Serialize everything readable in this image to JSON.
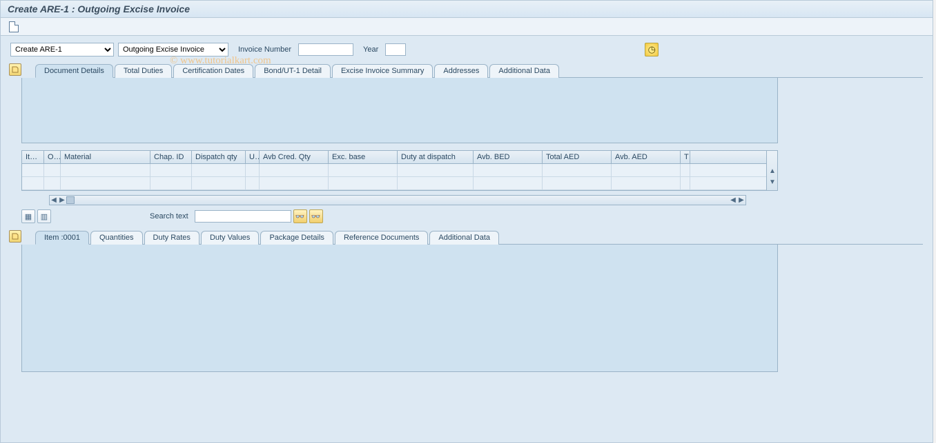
{
  "page_title": "Create ARE-1 : Outgoing Excise Invoice",
  "watermark": "© www.tutorialkart.com",
  "topbar": {
    "create_select": "Create ARE-1",
    "ref_select": "Outgoing Excise Invoice",
    "invoice_label": "Invoice Number",
    "invoice_value": "",
    "year_label": "Year",
    "year_value": ""
  },
  "tabs_main": [
    "Document Details",
    "Total Duties",
    "Certification Dates",
    "Bond/UT-1 Detail",
    "Excise Invoice Summary",
    "Addresses",
    "Additional Data"
  ],
  "active_tab_main": 0,
  "grid": {
    "columns": [
      "Item",
      "OK",
      "Material",
      "Chap. ID",
      "Dispatch qty",
      "U...",
      "Avb Cred. Qty",
      "Exc. base",
      "Duty at dispatch",
      "Avb. BED",
      "Total AED",
      "Avb. AED",
      "T"
    ],
    "rows": [
      [],
      []
    ]
  },
  "search": {
    "label": "Search text",
    "value": ""
  },
  "tabs_item": [
    "Item  :0001",
    "Quantities",
    "Duty Rates",
    "Duty Values",
    "Package Details",
    "Reference Documents",
    "Additional Data"
  ],
  "active_tab_item": 0
}
